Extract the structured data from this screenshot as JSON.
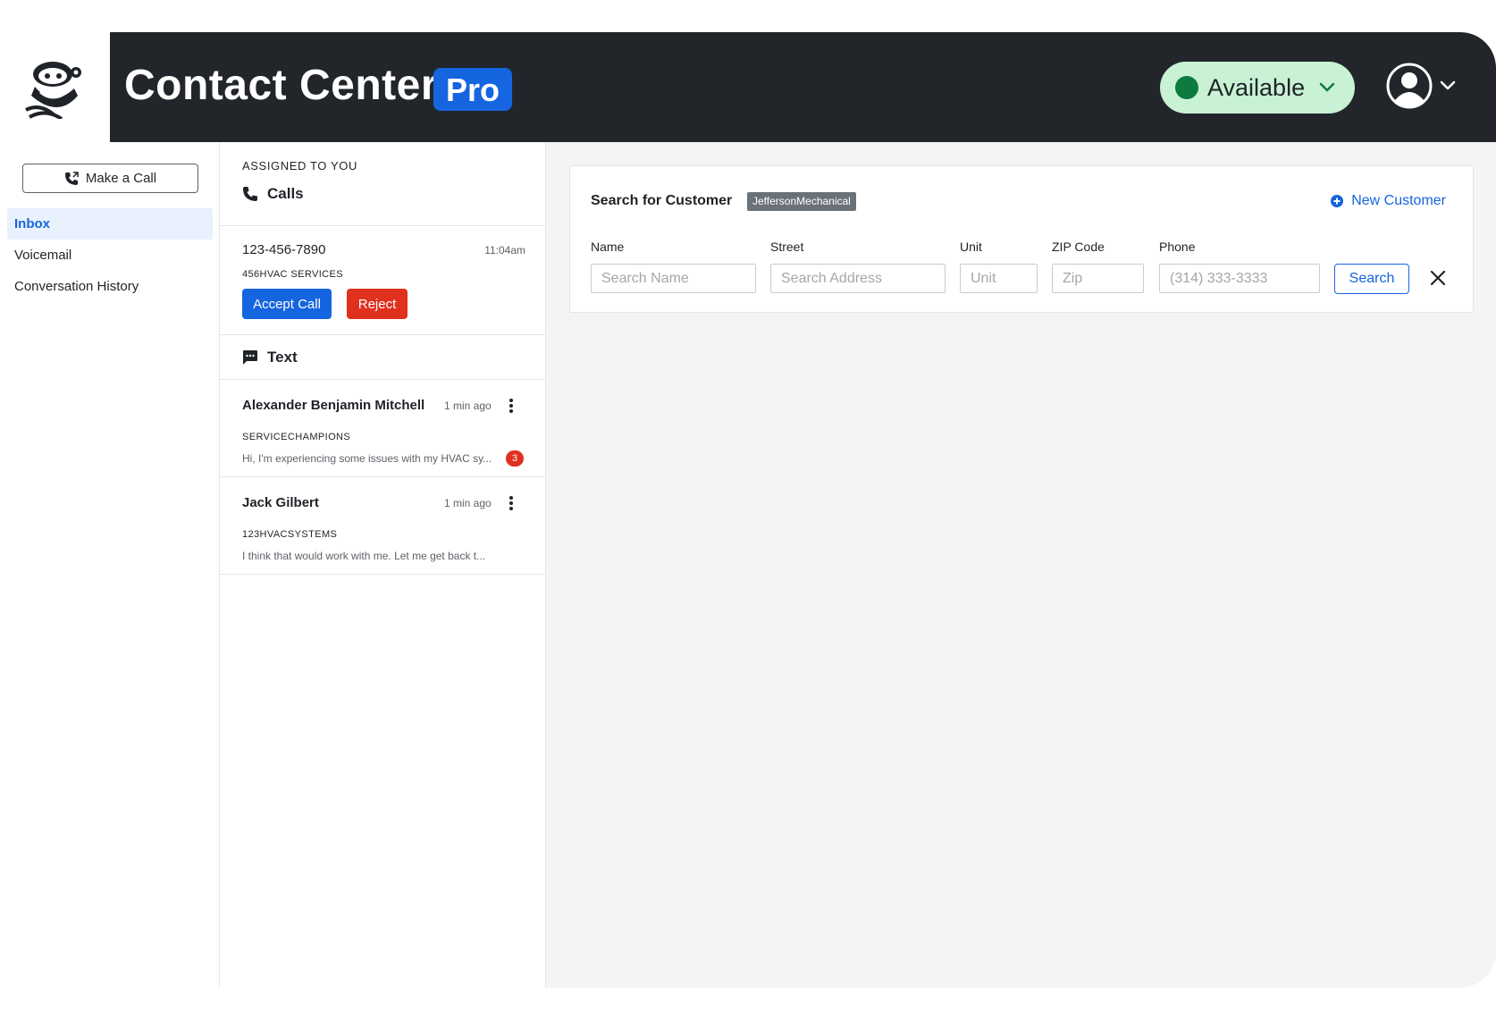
{
  "header": {
    "app_title": "Contact Center",
    "edition_badge": "Pro",
    "status": {
      "label": "Available",
      "color": "#0d7a3e"
    },
    "user_menu": {
      "icon": "user-avatar-icon"
    }
  },
  "sidebar": {
    "make_call_label": "Make a Call",
    "items": [
      {
        "label": "Inbox",
        "active": true
      },
      {
        "label": "Voicemail",
        "active": false
      },
      {
        "label": "Conversation History",
        "active": false
      }
    ]
  },
  "inbox": {
    "assigned_label": "ASSIGNED TO YOU",
    "calls": {
      "heading": "Calls",
      "items": [
        {
          "number": "123-456-7890",
          "time": "11:04am",
          "company": "456HVAC SERVICES",
          "accept_label": "Accept Call",
          "reject_label": "Reject"
        }
      ]
    },
    "text": {
      "heading": "Text",
      "items": [
        {
          "name": "Alexander Benjamin Mitchell",
          "time": "1 min ago",
          "company": "SERVICECHAMPIONS",
          "preview": "Hi, I'm experiencing some issues with my HVAC sy...",
          "unread": "3"
        },
        {
          "name": "Jack Gilbert",
          "time": "1 min ago",
          "company": "123HVACSYSTEMS",
          "preview": "I think that would work with me. Let me get back t...",
          "unread": null
        }
      ]
    }
  },
  "search": {
    "title": "Search for Customer",
    "tenant_badge": "JeffersonMechanical",
    "new_customer_label": "New Customer",
    "fields": {
      "name": {
        "label": "Name",
        "placeholder": "Search Name"
      },
      "street": {
        "label": "Street",
        "placeholder": "Search Address"
      },
      "unit": {
        "label": "Unit",
        "placeholder": "Unit"
      },
      "zip": {
        "label": "ZIP Code",
        "placeholder": "Zip"
      },
      "phone": {
        "label": "Phone",
        "placeholder": "(314) 333-3333"
      }
    },
    "search_button_label": "Search"
  },
  "colors": {
    "header_bg": "#22262b",
    "accent": "#1565e0",
    "danger": "#e0301e",
    "status_pill_bg": "#c9f2d5"
  }
}
